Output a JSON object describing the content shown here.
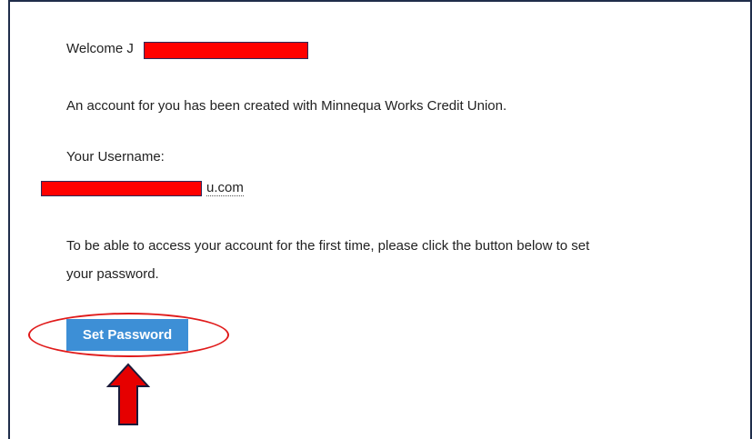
{
  "email": {
    "welcome_text": "Welcome J",
    "intro_text": "An account for you has been created with Minnequa Works Credit Union.",
    "username_label": "Your Username:",
    "username_suffix": "u.com",
    "instruction_line1": "To be able to access your account for the first time, please click the button below to set",
    "instruction_line2": "your password.",
    "button_label": "Set Password"
  },
  "annotations": {
    "highlight_color": "#e01a1a",
    "redaction_color": "#ff0000",
    "button_color": "#3d8fd6",
    "arrow_icon": "arrow-up-icon"
  }
}
